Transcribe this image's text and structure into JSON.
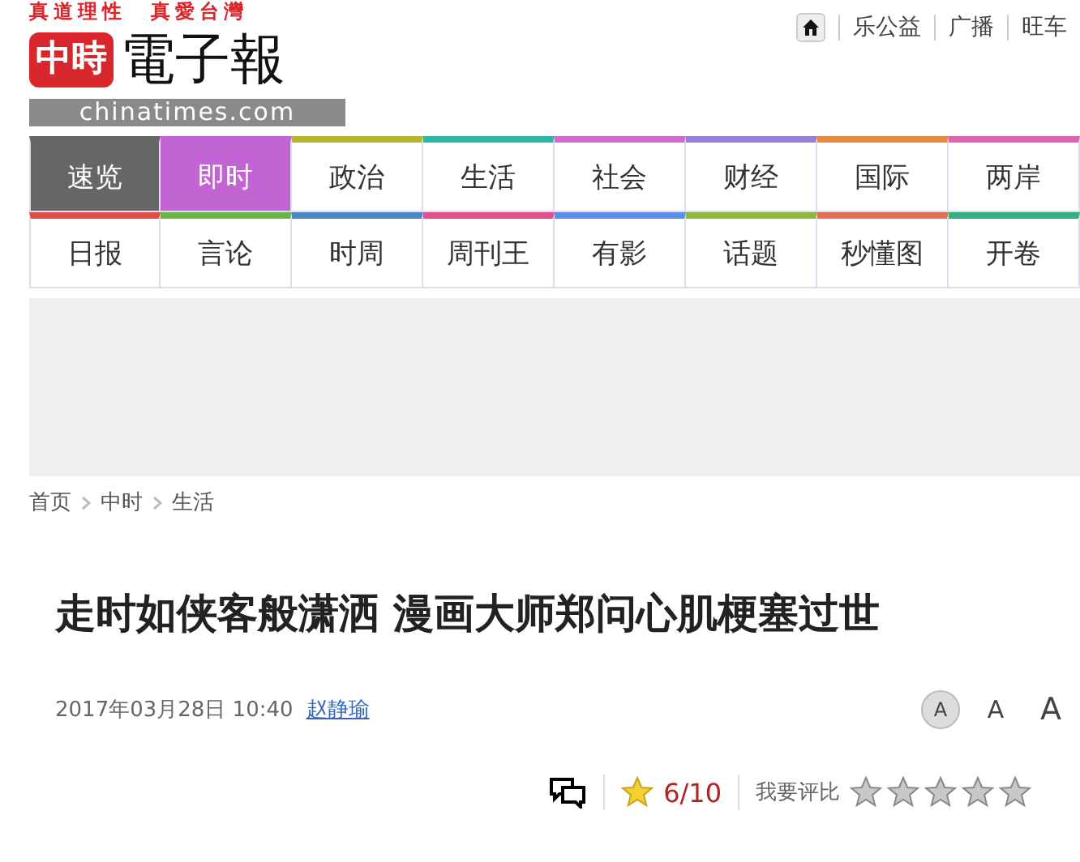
{
  "logo": {
    "slogan": "真道理性　真愛台灣",
    "badge": "中時",
    "name": "電子報",
    "domain": "chinatimes.com"
  },
  "top_links": [
    "乐公益",
    "广播",
    "旺车"
  ],
  "nav_rows": [
    [
      {
        "label": "速览",
        "color": "#666666",
        "filled": true
      },
      {
        "label": "即时",
        "color": "#c264d4",
        "filled": true
      },
      {
        "label": "政治",
        "color": "#b8b52e",
        "filled": false
      },
      {
        "label": "生活",
        "color": "#2fb6a6",
        "filled": false
      },
      {
        "label": "社会",
        "color": "#d36ad0",
        "filled": false
      },
      {
        "label": "财经",
        "color": "#9480d6",
        "filled": false
      },
      {
        "label": "国际",
        "color": "#e8883a",
        "filled": false
      },
      {
        "label": "两岸",
        "color": "#e060b4",
        "filled": false
      }
    ],
    [
      {
        "label": "日报",
        "color": "#dd4f45",
        "filled": false
      },
      {
        "label": "言论",
        "color": "#6ab44a",
        "filled": false
      },
      {
        "label": "时周",
        "color": "#4a88c6",
        "filled": false
      },
      {
        "label": "周刊王",
        "color": "#e0508a",
        "filled": false
      },
      {
        "label": "有影",
        "color": "#5a8ee8",
        "filled": false
      },
      {
        "label": "话题",
        "color": "#8cb840",
        "filled": false
      },
      {
        "label": "秒懂图",
        "color": "#e07050",
        "filled": false
      },
      {
        "label": "开卷",
        "color": "#30b080",
        "filled": false
      }
    ]
  ],
  "breadcrumb": [
    "首页",
    "中时",
    "生活"
  ],
  "headline": "走时如侠客般潇洒 漫画大师郑问心肌梗塞过世",
  "meta": {
    "date": "2017年03月28日 10:40",
    "author": "赵静瑜"
  },
  "font_sizes": [
    {
      "label": "A",
      "selected": true
    },
    {
      "label": "A",
      "selected": false
    },
    {
      "label": "A",
      "selected": false
    }
  ],
  "rating": {
    "score": "6/10",
    "rate_label": "我要评比",
    "stars": 0
  }
}
